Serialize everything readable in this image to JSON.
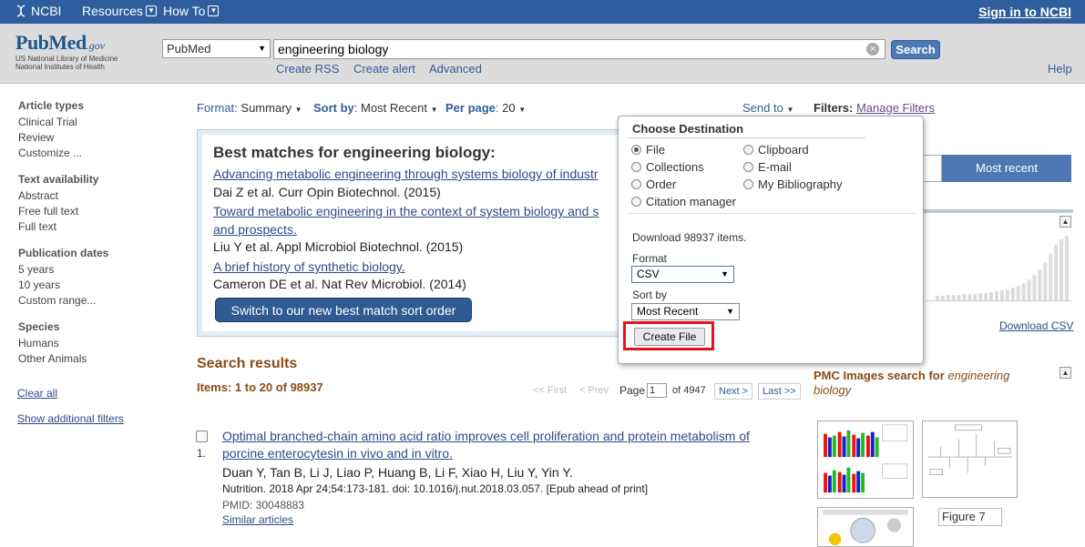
{
  "ncbi_bar": {
    "logo": "NCBI",
    "menu": [
      "Resources",
      "How To"
    ],
    "signin": "Sign in to NCBI"
  },
  "header": {
    "logo_pub": "Pub",
    "logo_med": "Med",
    "logo_gov": ".gov",
    "nlm_line1": "US National Library of Medicine",
    "nlm_line2": "National Institutes of Health",
    "database": "PubMed",
    "query": "engineering biology",
    "search_label": "Search",
    "links": [
      "Create RSS",
      "Create alert",
      "Advanced"
    ],
    "help": "Help"
  },
  "sidebar": {
    "sections": [
      {
        "title": "Article types",
        "items": [
          "Clinical Trial",
          "Review",
          "Customize ..."
        ]
      },
      {
        "title": "Text availability",
        "items": [
          "Abstract",
          "Free full text",
          "Full text"
        ]
      },
      {
        "title": "Publication dates",
        "items": [
          "5 years",
          "10 years",
          "Custom range..."
        ]
      },
      {
        "title": "Species",
        "items": [
          "Humans",
          "Other Animals"
        ]
      }
    ],
    "clear_all": "Clear all",
    "show_filters": "Show additional filters"
  },
  "format_bar": {
    "format_label": "Format",
    "format_value": "Summary",
    "sort_label": "Sort by",
    "sort_value": "Most Recent",
    "perpage_label": "Per page",
    "perpage_value": "20",
    "send_to": "Send to",
    "filters_label": "Filters:",
    "manage_filters": "Manage Filters"
  },
  "best_matches": {
    "title": "Best matches for engineering biology:",
    "items": [
      {
        "title": "Advancing metabolic engineering through systems biology of industr",
        "cite": "Dai Z et al. Curr Opin Biotechnol. (2015)"
      },
      {
        "title": "Toward metabolic engineering in the context of system biology and s",
        "title2": "and prospects.",
        "cite": "Liu Y et al. Appl Microbiol Biotechnol. (2015)"
      },
      {
        "title": "A brief history of synthetic biology.",
        "cite": "Cameron DE et al. Nat Rev Microbiol. (2014)"
      }
    ],
    "switch_button": "Switch to our new best match sort order"
  },
  "results": {
    "heading": "Search results",
    "items_label": "Items: 1 to 20 of 98937",
    "pager": {
      "first": "<< First",
      "prev": "< Prev",
      "page_label": "Page",
      "page_value": "1",
      "of": "of 4947",
      "next": "Next >",
      "last": "Last >>"
    },
    "list": [
      {
        "num": "1.",
        "title_line1": "Optimal branched-chain amino acid ratio improves cell proliferation and protein metabolism of",
        "title_line2": "porcine enterocytesin in vivo and in vitro.",
        "authors": "Duan Y, Tan B, Li J, Liao P, Huang B, Li F, Xiao H, Liu Y, Yin Y.",
        "journal": "Nutrition. 2018 Apr 24;54:173-181. doi: 10.1016/j.nut.2018.03.057. [Epub ahead of print]",
        "pmid": "PMID: 30048883",
        "similar": "Similar articles"
      }
    ]
  },
  "right_column": {
    "sort_button": "Most recent",
    "download_csv": "Download CSV",
    "pmc_heading": "PMC Images search for",
    "pmc_query": "engineering biology",
    "figure_alt": "Figure 7"
  },
  "send_to_popup": {
    "title": "Choose Destination",
    "destinations": [
      {
        "label": "File",
        "selected": true
      },
      {
        "label": "Clipboard",
        "selected": false
      },
      {
        "label": "Collections",
        "selected": false
      },
      {
        "label": "E-mail",
        "selected": false
      },
      {
        "label": "Order",
        "selected": false
      },
      {
        "label": "My Bibliography",
        "selected": false
      },
      {
        "label": "Citation manager",
        "selected": false
      }
    ],
    "download_msg": "Download 98937 items.",
    "format_label": "Format",
    "format_value": "CSV",
    "sortby_label": "Sort by",
    "sortby_value": "Most Recent",
    "create_button": "Create File"
  },
  "colors": {
    "ncbi_bar": "#2e5e9e",
    "highlight": "#e3141c",
    "heading_brown": "#8a4b16"
  }
}
